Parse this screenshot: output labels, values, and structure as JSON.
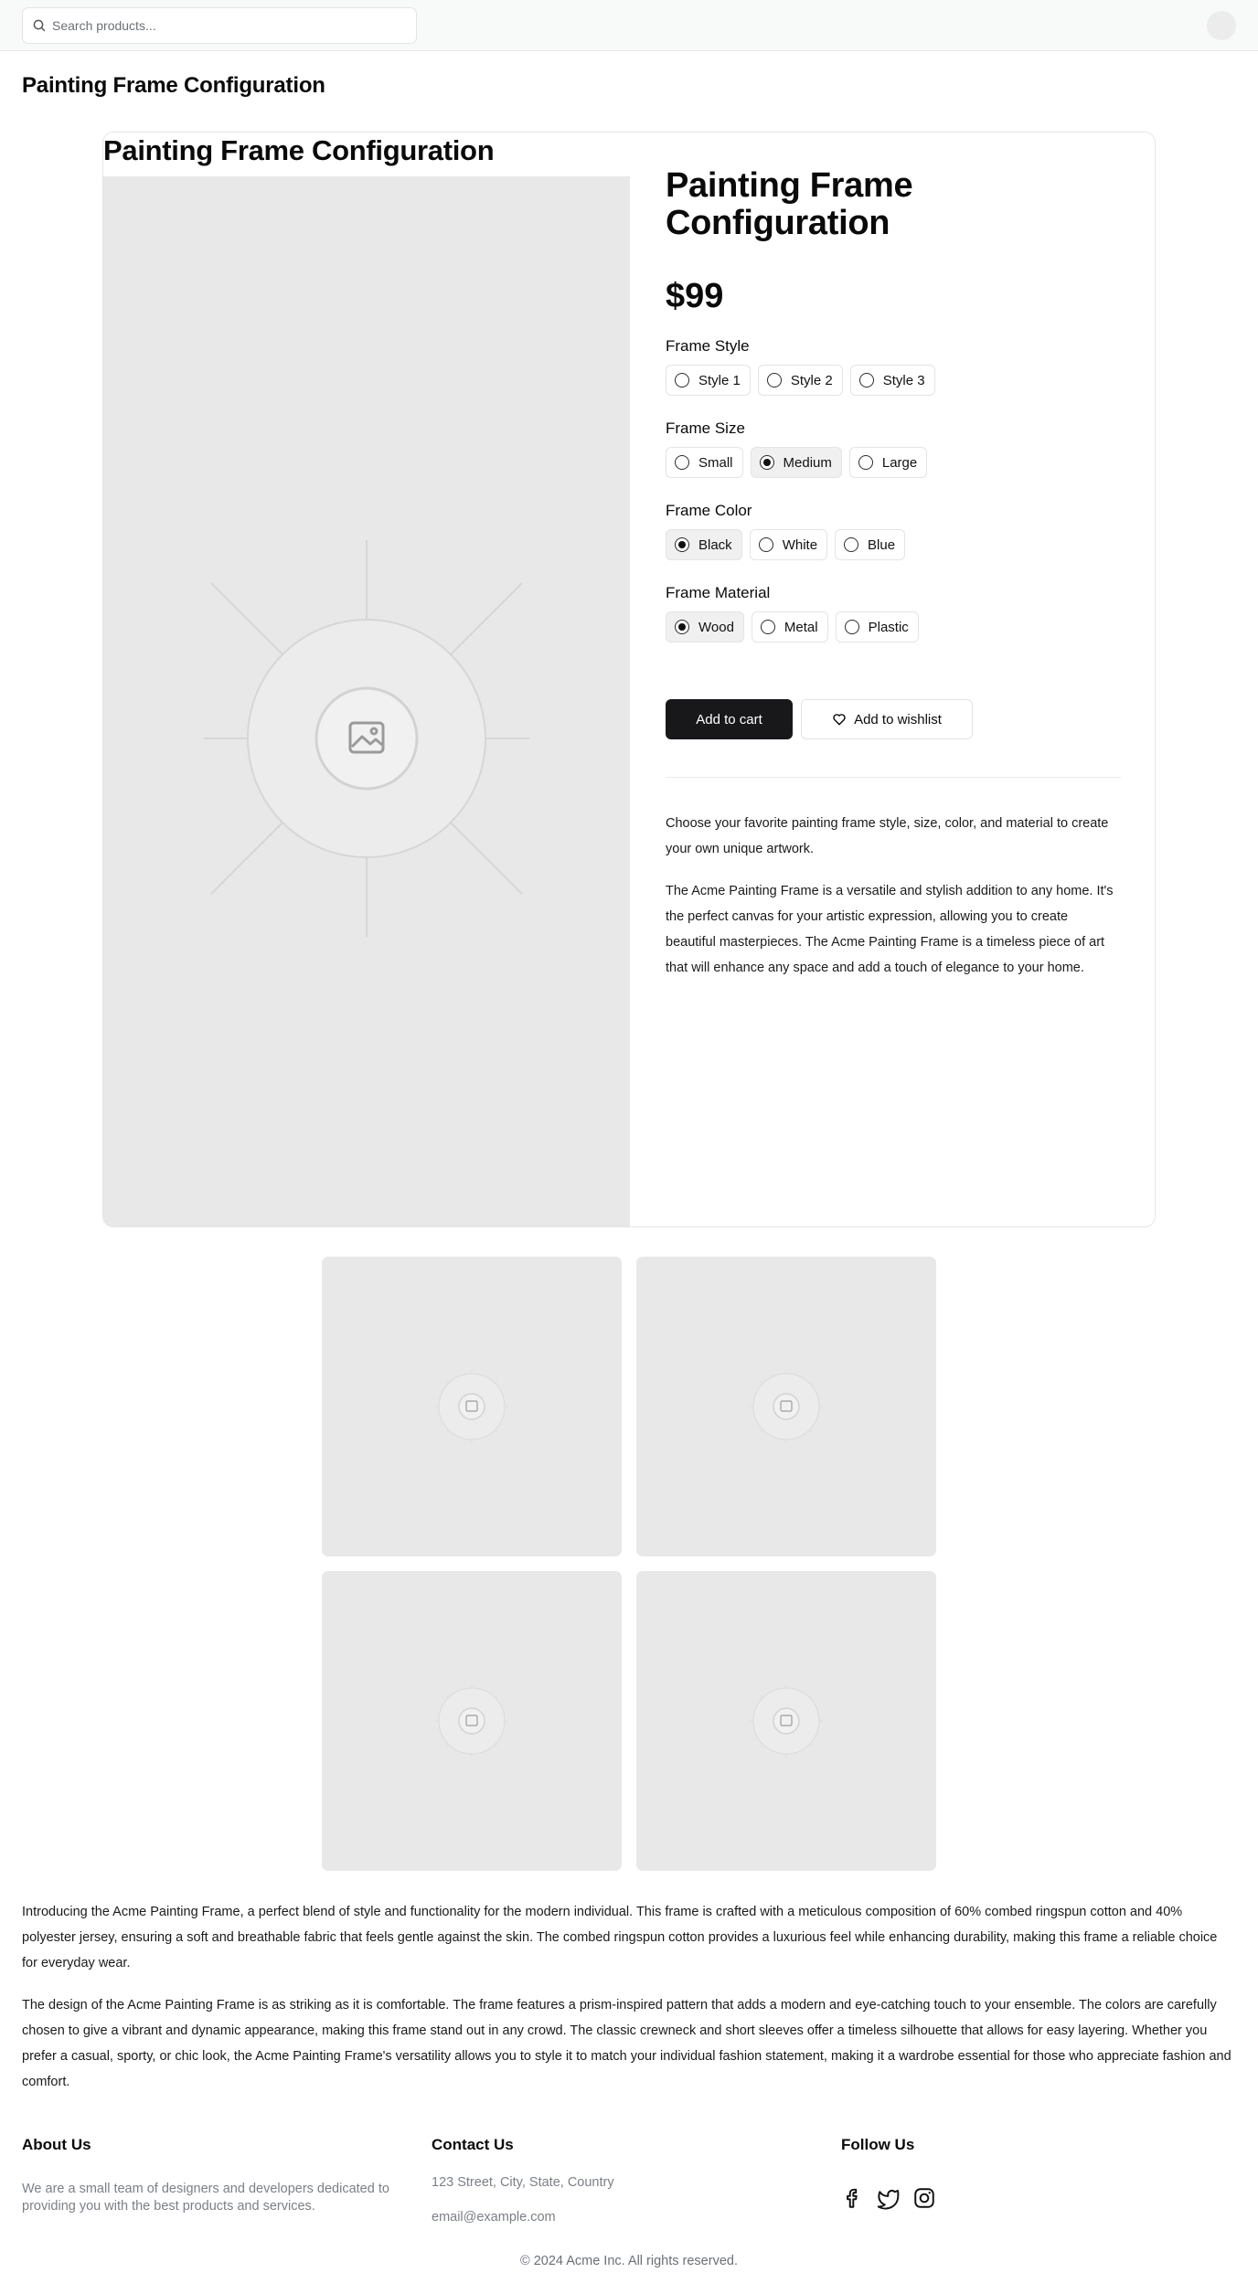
{
  "header": {
    "search_placeholder": "Search products..."
  },
  "page": {
    "title": "Painting Frame Configuration"
  },
  "card": {
    "title": "Painting Frame Configuration",
    "product_name": "Painting Frame Configuration",
    "price": "$99",
    "options": [
      {
        "label": "Frame Style",
        "choices": [
          "Style 1",
          "Style 2",
          "Style 3"
        ],
        "selected": null
      },
      {
        "label": "Frame Size",
        "choices": [
          "Small",
          "Medium",
          "Large"
        ],
        "selected": "Medium"
      },
      {
        "label": "Frame Color",
        "choices": [
          "Black",
          "White",
          "Blue"
        ],
        "selected": "Black"
      },
      {
        "label": "Frame Material",
        "choices": [
          "Wood",
          "Metal",
          "Plastic"
        ],
        "selected": "Wood"
      }
    ],
    "add_to_cart": "Add to cart",
    "add_to_wishlist": "Add to wishlist",
    "descriptions": [
      "Choose your favorite painting frame style, size, color, and material to create your own unique artwork.",
      "The Acme Painting Frame is a versatile and stylish addition to any home. It's the perfect canvas for your artistic expression, allowing you to create beautiful masterpieces. The Acme Painting Frame is a timeless piece of art that will enhance any space and add a touch of elegance to your home."
    ]
  },
  "details": [
    "Introducing the Acme Painting Frame, a perfect blend of style and functionality for the modern individual. This frame is crafted with a meticulous composition of 60% combed ringspun cotton and 40% polyester jersey, ensuring a soft and breathable fabric that feels gentle against the skin. The combed ringspun cotton provides a luxurious feel while enhancing durability, making this frame a reliable choice for everyday wear.",
    "The design of the Acme Painting Frame is as striking as it is comfortable. The frame features a prism-inspired pattern that adds a modern and eye-catching touch to your ensemble. The colors are carefully chosen to give a vibrant and dynamic appearance, making this frame stand out in any crowd. The classic crewneck and short sleeves offer a timeless silhouette that allows for easy layering. Whether you prefer a casual, sporty, or chic look, the Acme Painting Frame's versatility allows you to style it to match your individual fashion statement, making it a wardrobe essential for those who appreciate fashion and comfort."
  ],
  "footer": {
    "about_title": "About Us",
    "about_text_1": "We are a small team of designers and developers dedicated to",
    "about_text_2": "providing you with the best products and services.",
    "contact_title": "Contact Us",
    "address": "123 Street, City, State, Country",
    "email": "email@example.com",
    "follow_title": "Follow Us",
    "social_icons": [
      "facebook-icon",
      "twitter-icon",
      "instagram-icon"
    ],
    "copyright": "© 2024 Acme Inc. All rights reserved."
  },
  "colors": {
    "primary_button": "#18181b",
    "placeholder_bg": "#e8e8e8",
    "muted_text": "#7b7f86"
  }
}
